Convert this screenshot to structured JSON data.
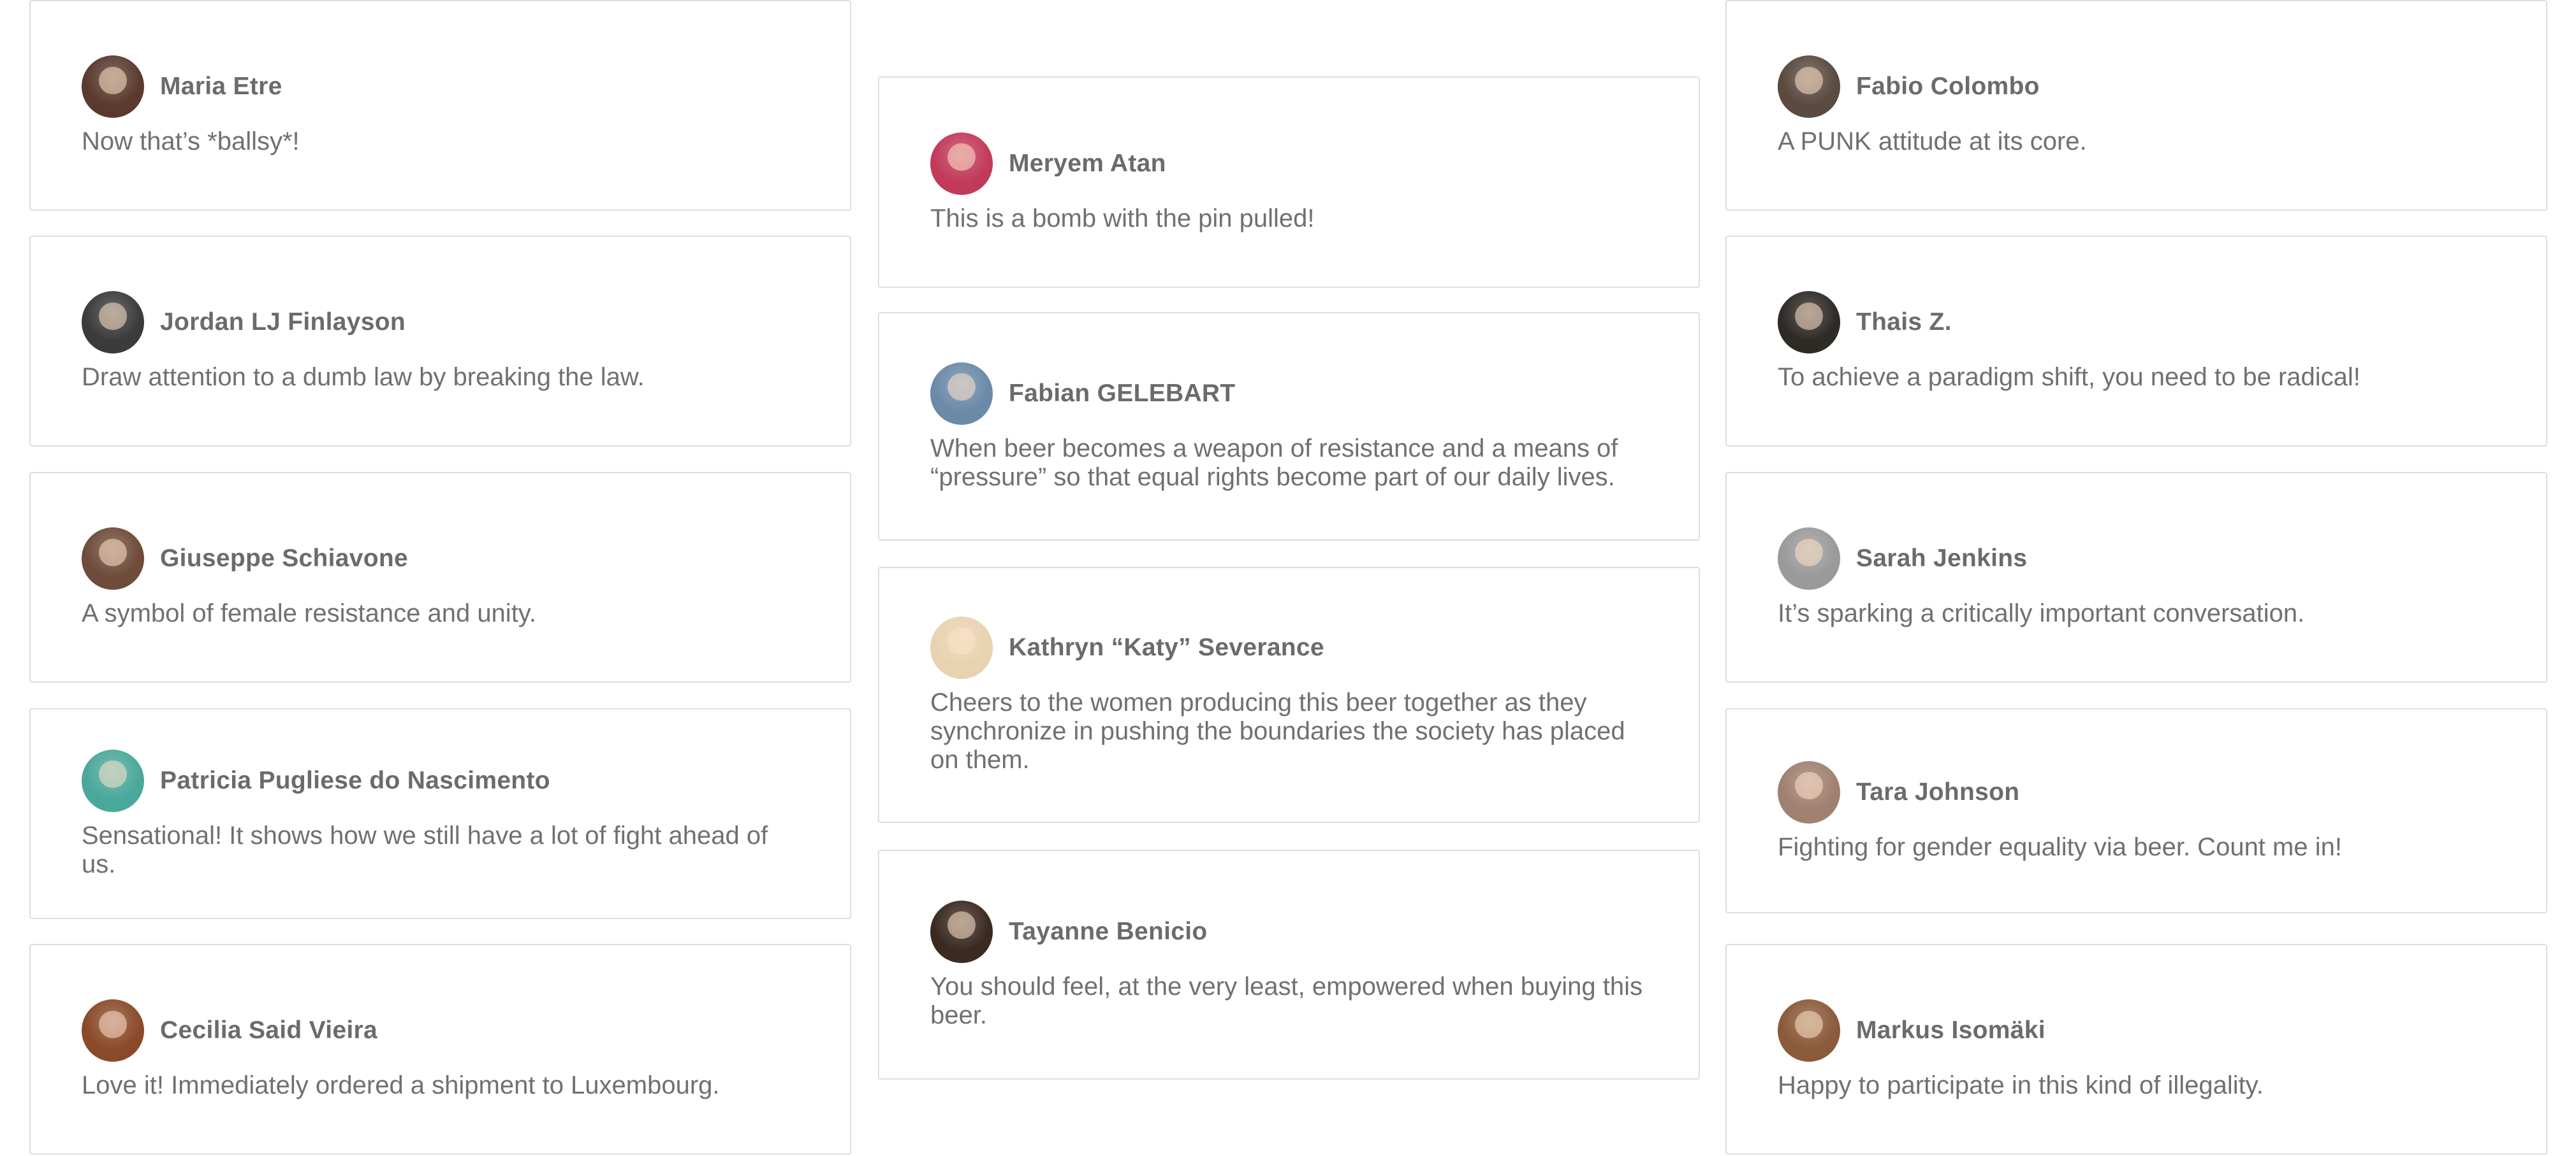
{
  "columns": [
    {
      "cards": [
        {
          "name": "Maria Etre",
          "text": "Now that’s *ballsy*!",
          "avatar_color": "#5a3a2e"
        },
        {
          "name": "Jordan LJ Finlayson",
          "text": "Draw attention to a dumb law by breaking the law.",
          "avatar_color": "#3b3b3b"
        },
        {
          "name": "Giuseppe Schiavone",
          "text": "A symbol of female resistance and unity.",
          "avatar_color": "#6e4b3a"
        },
        {
          "name": "Patricia Pugliese do Nascimento",
          "text": "Sensational! It shows how we still have a lot of fight ahead of us.",
          "avatar_color": "#4aa89a"
        },
        {
          "name": "Cecilia Said Vieira",
          "text": "Love it! Immediately ordered a shipment to Luxembourg.",
          "avatar_color": "#8a4a2a"
        }
      ]
    },
    {
      "cards": [
        {
          "name": "Meryem Atan",
          "text": "This is a bomb with the pin pulled!",
          "avatar_color": "#c23a5a"
        },
        {
          "name": "Fabian GELEBART",
          "text": "When beer becomes a weapon of resistance and a means of “pressure” so that equal rights become part of our daily lives.",
          "avatar_color": "#6a8aa8"
        },
        {
          "name": "Kathryn “Katy” Severance",
          "text": "Cheers to the women producing this beer together as they synchronize in pushing the boundaries the society has placed on them.",
          "avatar_color": "#e8d2b0"
        },
        {
          "name": "Tayanne Benicio",
          "text": "You should feel, at the very least, empowered when buying this beer.",
          "avatar_color": "#3a2a20"
        }
      ]
    },
    {
      "cards": [
        {
          "name": "Fabio Colombo",
          "text": "A PUNK attitude at its core.",
          "avatar_color": "#5a4a40"
        },
        {
          "name": "Thais Z.",
          "text": "To achieve a paradigm shift, you need to be radical!",
          "avatar_color": "#2e2a26"
        },
        {
          "name": "Sarah Jenkins",
          "text": "It’s sparking a critically important conversation.",
          "avatar_color": "#9a9a9a"
        },
        {
          "name": "Tara Johnson",
          "text": "Fighting for gender equality via beer. Count me in!",
          "avatar_color": "#a08070"
        },
        {
          "name": "Markus Isomäki",
          "text": "Happy to participate in this kind of illegality.",
          "avatar_color": "#8a5a3a"
        }
      ]
    }
  ]
}
